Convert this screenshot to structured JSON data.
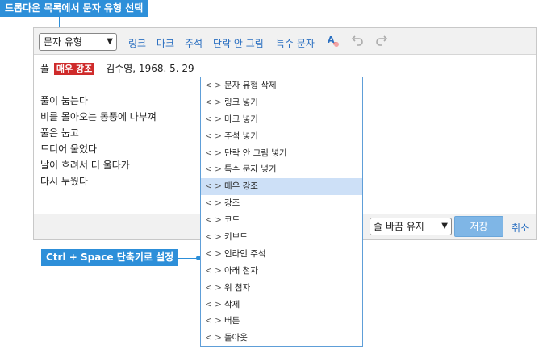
{
  "callouts": {
    "top": "드롭다운 목록에서 문자 유형 선택",
    "bottom": "Ctrl + Space 단축키로 설정"
  },
  "toolbar": {
    "type_select": "문자 유형",
    "buttons": [
      "링크",
      "마크",
      "주석",
      "단락 안 그림",
      "특수 문자"
    ],
    "icons": [
      "spellcheck-icon",
      "undo-icon",
      "redo-icon"
    ]
  },
  "content": {
    "line1_before": "풀",
    "line1_badge": "매우 강조",
    "line1_after": "—김수영, 1968. 5. 29",
    "poem": [
      "풀이 눕는다",
      "비를 몰아오는 동풍에 나부껴",
      "풀은 눕고",
      "드디어 울었다",
      "날이 흐려서 더 울다가",
      "다시 누웠다"
    ]
  },
  "bottombar": {
    "wrap_select": "줄 바꿈 유지",
    "save": "저장",
    "cancel": "취소"
  },
  "dropdown": {
    "code_icon": "< >",
    "selected_index": 6,
    "items": [
      "문자 유형 삭제",
      "링크 넣기",
      "마크 넣기",
      "주석 넣기",
      "단락 안 그림 넣기",
      "특수 문자 넣기",
      "매우 강조",
      "강조",
      "코드",
      "키보드",
      "인라인 주석",
      "아래 첨자",
      "위 첨자",
      "삭제",
      "버튼",
      "돌아옷"
    ]
  },
  "colors": {
    "callout": "#2d8fd9",
    "badge": "#cf2b2b",
    "link": "#2a6fc1",
    "selected_row": "#cde0f7"
  }
}
